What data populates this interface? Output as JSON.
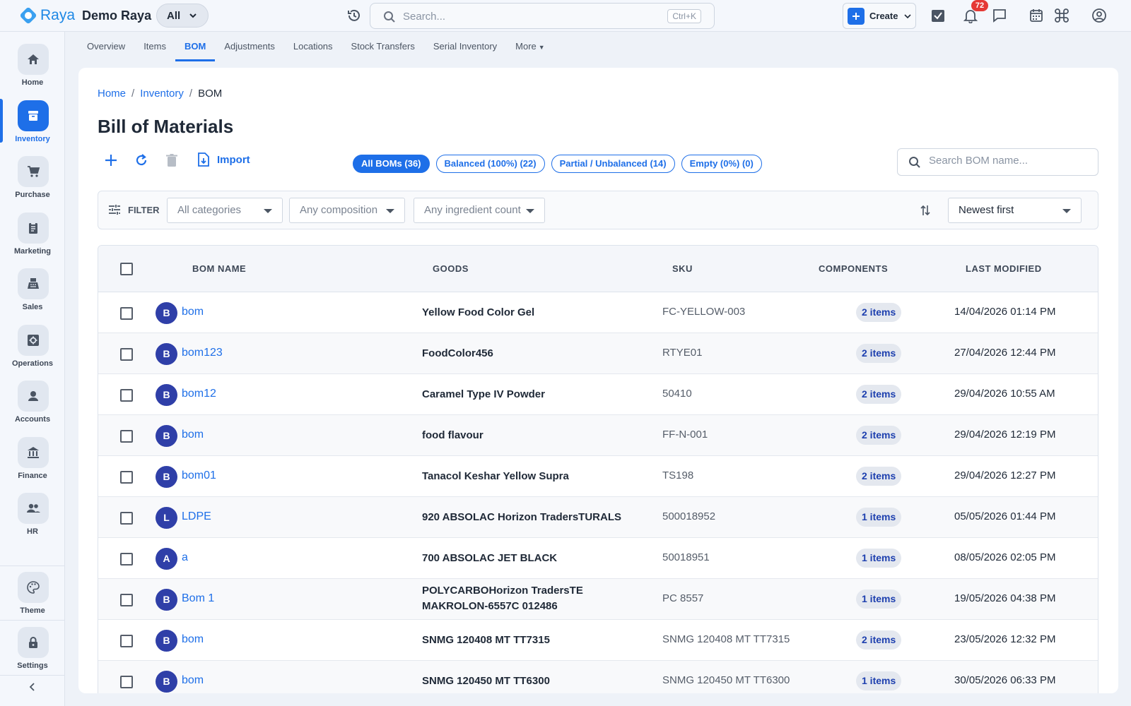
{
  "app": {
    "brand": "Raya",
    "tenant": "Demo Raya",
    "scope": "All"
  },
  "search": {
    "placeholder": "Search...",
    "shortcut": "Ctrl+K"
  },
  "create": {
    "label": "Create"
  },
  "notifications": {
    "count": "72"
  },
  "sidebar": {
    "items": [
      {
        "label": "Home",
        "icon": "home-icon"
      },
      {
        "label": "Inventory",
        "icon": "archive-icon",
        "active": true
      },
      {
        "label": "Purchase",
        "icon": "cart-icon"
      },
      {
        "label": "Marketing",
        "icon": "clipboard-icon"
      },
      {
        "label": "Sales",
        "icon": "register-icon"
      },
      {
        "label": "Operations",
        "icon": "gear-box-icon"
      },
      {
        "label": "Accounts",
        "icon": "person-icon"
      },
      {
        "label": "Finance",
        "icon": "bank-icon"
      },
      {
        "label": "HR",
        "icon": "people-icon"
      }
    ],
    "theme": "Theme",
    "settings": "Settings"
  },
  "subtabs": [
    "Overview",
    "Items",
    "BOM",
    "Adjustments",
    "Locations",
    "Stock Transfers",
    "Serial Inventory",
    "More"
  ],
  "breadcrumb": {
    "home": "Home",
    "section": "Inventory",
    "current": "BOM"
  },
  "page": {
    "title": "Bill of Materials",
    "import_label": "Import"
  },
  "chips": [
    {
      "label": "All BOMs (36)",
      "active": true
    },
    {
      "label": "Balanced (100%) (22)"
    },
    {
      "label": "Partial / Unbalanced (14)"
    },
    {
      "label": "Empty (0%) (0)"
    }
  ],
  "bom_search": {
    "placeholder": "Search BOM name..."
  },
  "filter": {
    "label": "FILTER",
    "categories": "All categories",
    "composition": "Any composition",
    "ingredients": "Any ingredient count",
    "sort": "Newest first"
  },
  "table": {
    "headers": {
      "name": "BOM NAME",
      "goods": "GOODS",
      "sku": "SKU",
      "components": "COMPONENTS",
      "modified": "LAST MODIFIED"
    },
    "rows": [
      {
        "initial": "B",
        "name": "bom",
        "goods": "Yellow Food Color Gel",
        "sku": "FC-YELLOW-003",
        "components": "2 items",
        "modified": "14/04/2026 01:14 PM"
      },
      {
        "initial": "B",
        "name": "bom123",
        "goods": "FoodColor456",
        "sku": "RTYE01",
        "components": "2 items",
        "modified": "27/04/2026 12:44 PM"
      },
      {
        "initial": "B",
        "name": "bom12",
        "goods": "Caramel Type IV Powder",
        "sku": "50410",
        "components": "2 items",
        "modified": "29/04/2026 10:55 AM"
      },
      {
        "initial": "B",
        "name": "bom",
        "goods": "food flavour",
        "sku": "FF-N-001",
        "components": "2 items",
        "modified": "29/04/2026 12:19 PM"
      },
      {
        "initial": "B",
        "name": "bom01",
        "goods": "Tanacol Keshar Yellow Supra",
        "sku": "TS198",
        "components": "2 items",
        "modified": "29/04/2026 12:27 PM"
      },
      {
        "initial": "L",
        "name": "LDPE",
        "goods": "920 ABSOLAC Horizon TradersTURALS",
        "sku": "500018952",
        "components": "1 items",
        "modified": "05/05/2026 01:44 PM"
      },
      {
        "initial": "A",
        "name": "a",
        "goods": "700 ABSOLAC JET BLACK",
        "sku": "50018951",
        "components": "1 items",
        "modified": "08/05/2026 02:05 PM"
      },
      {
        "initial": "B",
        "name": "Bom 1",
        "goods": "POLYCARBOHorizon TradersTE MAKROLON-6557C 012486",
        "sku": "PC 8557",
        "components": "1 items",
        "modified": "19/05/2026 04:38 PM"
      },
      {
        "initial": "B",
        "name": "bom",
        "goods": "SNMG 120408 MT TT7315",
        "sku": "SNMG 120408 MT TT7315",
        "components": "2 items",
        "modified": "23/05/2026 12:32 PM"
      },
      {
        "initial": "B",
        "name": "bom",
        "goods": "SNMG 120450 MT TT6300",
        "sku": "SNMG 120450 MT TT6300",
        "components": "1 items",
        "modified": "30/05/2026 06:33 PM"
      }
    ]
  },
  "colors": {
    "accent": "#1e6fe8",
    "avatar": "#2f3fa8",
    "badge": "#e53935"
  }
}
